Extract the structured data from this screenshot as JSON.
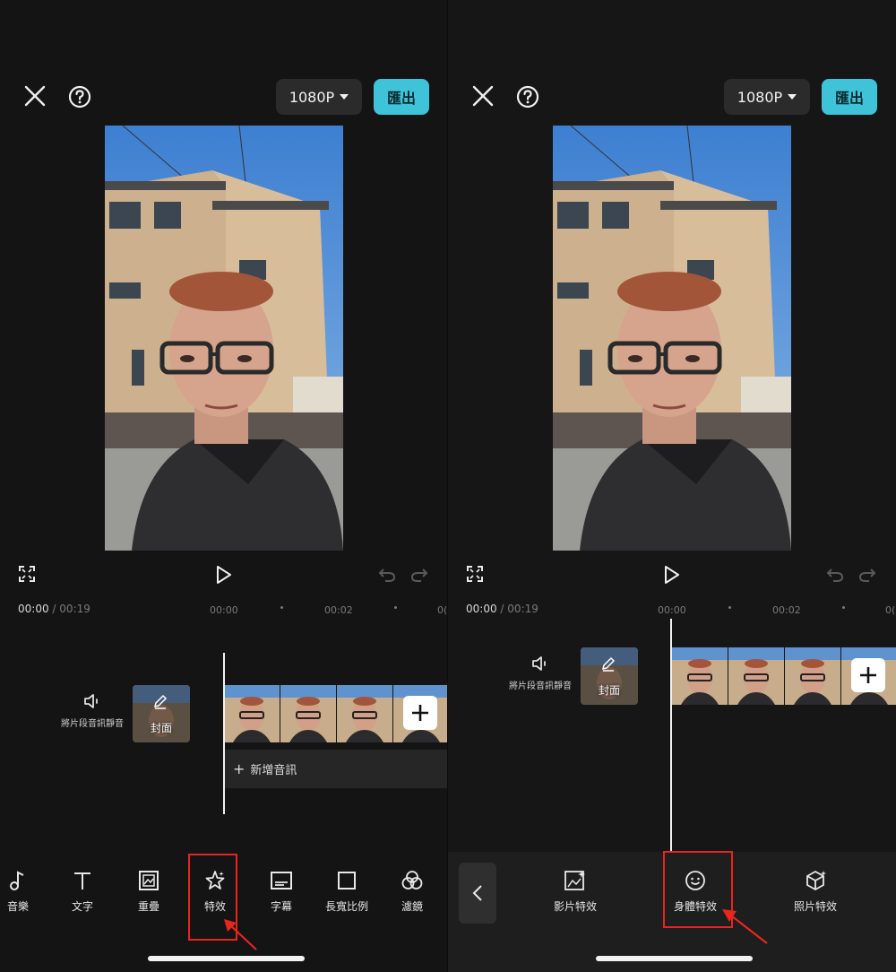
{
  "header": {
    "close_icon": "close-icon",
    "help_icon": "help-icon",
    "resolution_label": "1080P",
    "export_label": "匯出",
    "export_color": "#3fc3d8"
  },
  "controls": {
    "fullscreen_icon": "fullscreen-icon",
    "play_icon": "play-icon",
    "undo_icon": "undo-icon",
    "redo_icon": "redo-icon"
  },
  "timeline": {
    "current_time": "00:00",
    "separator": "/",
    "total_time": "00:19",
    "tick_start": "00:00",
    "tick_mid": "00:02",
    "tick_end_clip": "0("
  },
  "track": {
    "mute_label": "將片段音訊靜音",
    "cover_label": "封面",
    "add_audio_label": "新增音訊"
  },
  "toolbar_main": {
    "items": [
      {
        "label": "音樂",
        "icon": "music-note-icon"
      },
      {
        "label": "文字",
        "icon": "text-icon"
      },
      {
        "label": "重疊",
        "icon": "overlay-icon"
      },
      {
        "label": "特效",
        "icon": "effects-star-icon",
        "highlighted": true
      },
      {
        "label": "字幕",
        "icon": "captions-icon"
      },
      {
        "label": "長寬比例",
        "icon": "aspect-ratio-icon"
      },
      {
        "label": "濾鏡",
        "icon": "filters-icon"
      }
    ]
  },
  "toolbar_effects": {
    "back_icon": "chevron-left-icon",
    "items": [
      {
        "label": "影片特效",
        "icon": "video-effects-icon"
      },
      {
        "label": "身體特效",
        "icon": "body-effects-face-icon",
        "highlighted": true
      },
      {
        "label": "照片特效",
        "icon": "photo-effects-cube-icon"
      }
    ]
  },
  "annotation_color": "#e8251e"
}
